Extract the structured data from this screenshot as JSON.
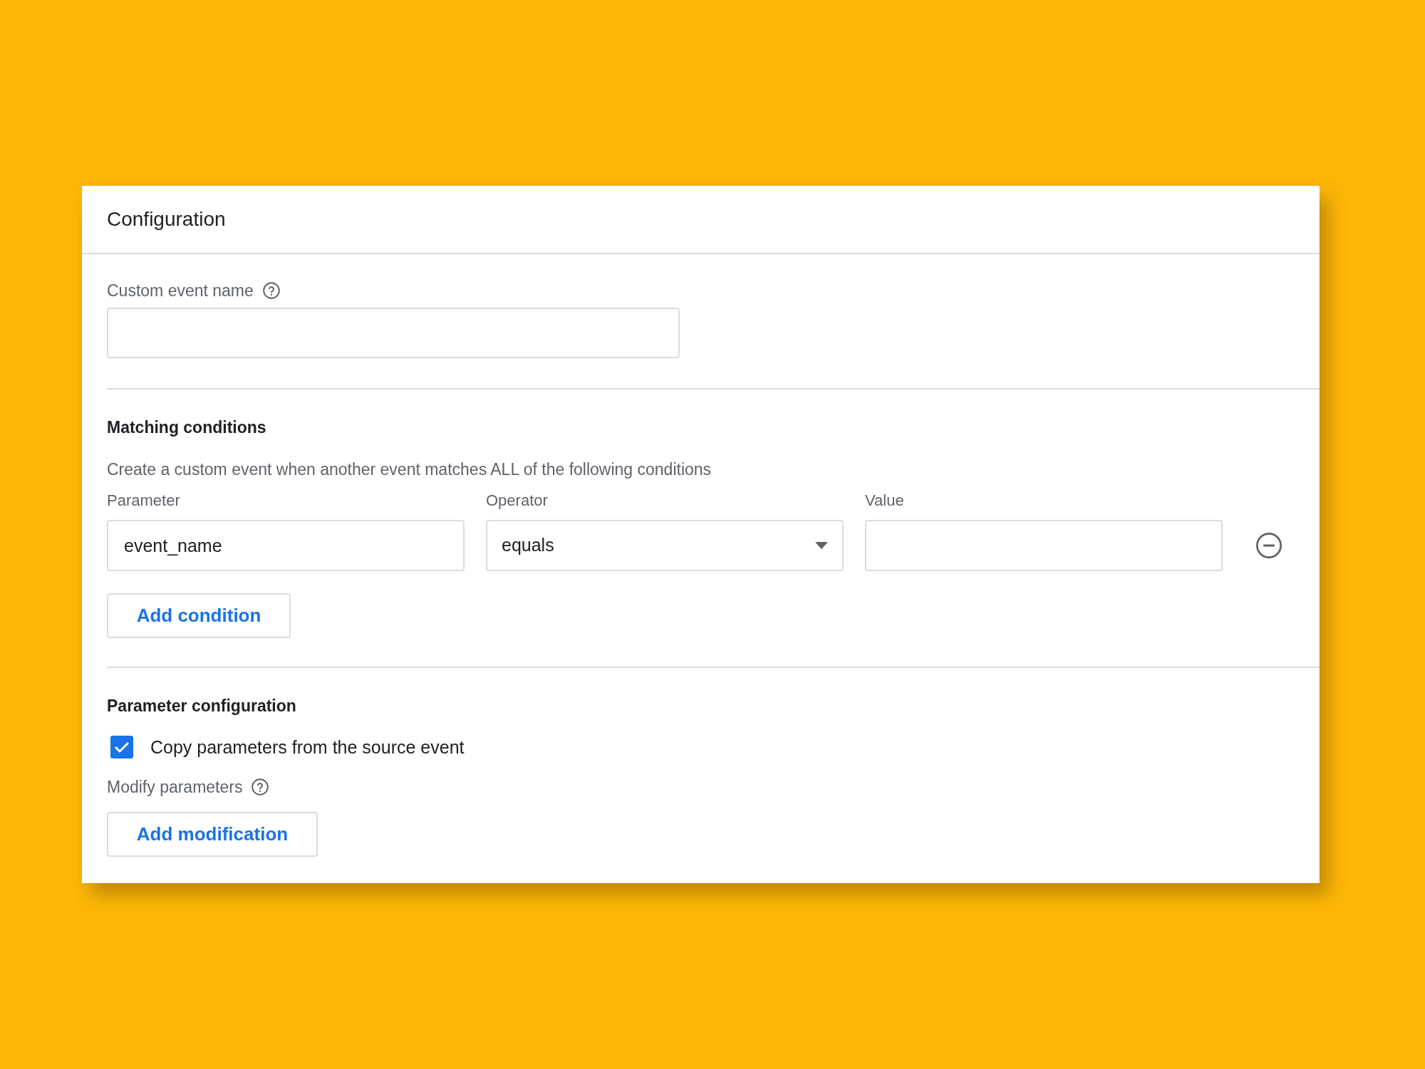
{
  "card": {
    "title": "Configuration"
  },
  "custom_event": {
    "label": "Custom event name"
  },
  "matching": {
    "heading": "Matching conditions",
    "description": "Create a custom event when another event matches ALL of the following conditions",
    "columns": [
      "Parameter",
      "Operator",
      "Value"
    ],
    "condition": {
      "parameter": "event_name",
      "operator": "equals"
    },
    "add_button": "Add condition"
  },
  "parameter_config": {
    "heading": "Parameter configuration",
    "copy": {
      "label": "Copy parameters from the source event",
      "checked": true
    },
    "modify_label": "Modify parameters",
    "add_button": "Add modification"
  }
}
